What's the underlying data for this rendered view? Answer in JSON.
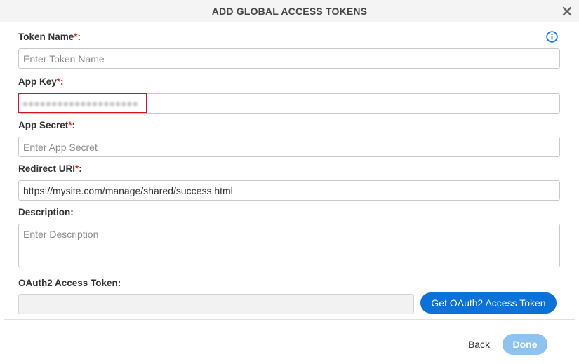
{
  "dialog": {
    "title": "ADD GLOBAL ACCESS TOKENS"
  },
  "fields": {
    "token_name": {
      "label": "Token Name",
      "placeholder": "Enter Token Name",
      "value": ""
    },
    "app_key": {
      "label": "App Key",
      "value": ""
    },
    "app_secret": {
      "label": "App Secret",
      "placeholder": "Enter App Secret",
      "value": ""
    },
    "redirect_uri": {
      "label": "Redirect URI",
      "value": "https://mysite.com/manage/shared/success.html"
    },
    "description": {
      "label": "Description:",
      "placeholder": "Enter Description"
    },
    "oauth_token": {
      "label": "OAuth2 Access Token:",
      "value": ""
    }
  },
  "required_marker": "*",
  "label_suffix": ":",
  "buttons": {
    "get_token": "Get OAuth2 Access Token",
    "back": "Back",
    "done": "Done"
  },
  "colors": {
    "primary": "#0a72d8",
    "done_disabled": "#8ec2f0",
    "required": "#e0252c",
    "highlight": "#d0141a"
  }
}
